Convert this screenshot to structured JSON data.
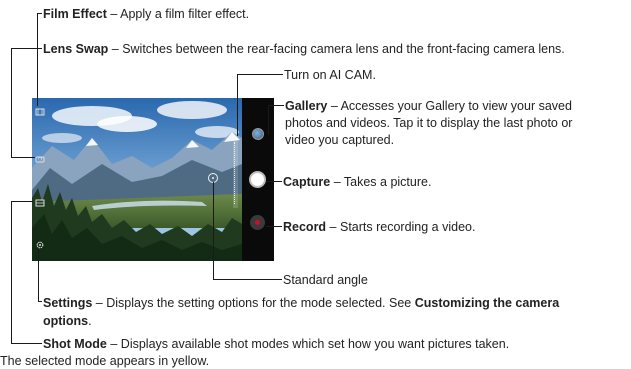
{
  "annotations": {
    "film_effect": {
      "name": "Film Effect",
      "desc": " – Apply a film filter effect."
    },
    "lens_swap": {
      "name": "Lens Swap",
      "desc": " – Switches between the rear-facing camera lens and the front-facing camera lens."
    },
    "ai_cam": {
      "text": "Turn on AI CAM."
    },
    "gallery": {
      "name": "Gallery",
      "line1": " – Accesses your Gallery to view your saved",
      "line2": "photos and videos. Tap it to display the last photo or",
      "line3": "video you captured."
    },
    "capture": {
      "name": "Capture",
      "desc": " – Takes a picture."
    },
    "record": {
      "name": "Record",
      "desc": " – Starts recording a video."
    },
    "standard_angle": {
      "text": "Standard angle"
    },
    "settings": {
      "name": "Settings",
      "line1": " – Displays the setting options for the mode selected. See ",
      "link": "Customizing the camera",
      "line2": "options",
      "line2_end": "."
    },
    "shot_mode": {
      "name": "Shot Mode",
      "line1": " – Displays available shot modes which set how you want pictures taken.",
      "line2": "The selected mode appears in yellow."
    }
  },
  "colors": {
    "record_red": "#c8102e",
    "sky_top": "#2f6fb5",
    "sky_bottom": "#a9c9e6"
  },
  "icons": {
    "film_effect": "film-icon",
    "lens_swap": "camera-switch-icon",
    "shot_mode": "shot-mode-icon",
    "settings": "gear-icon",
    "ai_cam": "ai-cam-icon",
    "gallery": "gallery-thumbnail",
    "capture": "capture-button",
    "record": "record-button",
    "standard_angle": "angle-icon"
  }
}
